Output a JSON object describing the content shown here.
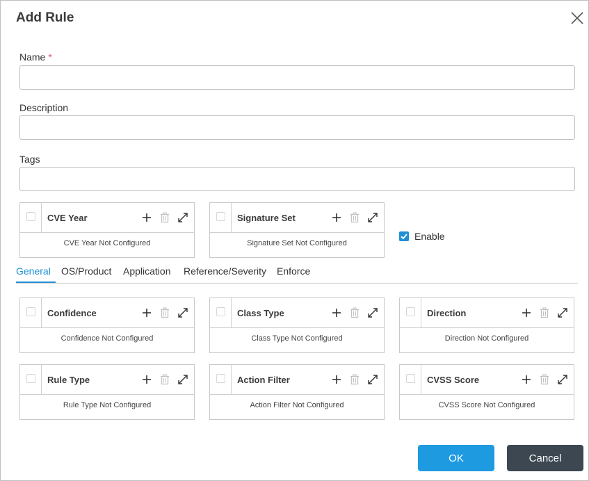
{
  "dialog": {
    "title": "Add Rule"
  },
  "form": {
    "name_label": "Name",
    "name_required_mark": "*",
    "name_value": "",
    "description_label": "Description",
    "description_value": "",
    "tags_label": "Tags",
    "tags_value": ""
  },
  "top_cards": [
    {
      "title": "CVE Year",
      "status": "CVE Year Not Configured"
    },
    {
      "title": "Signature Set",
      "status": "Signature Set Not Configured"
    }
  ],
  "enable": {
    "label": "Enable",
    "checked": true
  },
  "tabs": [
    "General",
    "OS/Product",
    "Application",
    "Reference/Severity",
    "Enforce"
  ],
  "active_tab": "General",
  "general_cards": [
    {
      "title": "Confidence",
      "status": "Confidence Not Configured"
    },
    {
      "title": "Class Type",
      "status": "Class Type Not Configured"
    },
    {
      "title": "Direction",
      "status": "Direction Not Configured"
    },
    {
      "title": "Rule Type",
      "status": "Rule Type Not Configured"
    },
    {
      "title": "Action Filter",
      "status": "Action Filter Not Configured"
    },
    {
      "title": "CVSS Score",
      "status": "CVSS Score Not Configured"
    }
  ],
  "icons": {
    "close": "close-icon",
    "add": "plus-icon",
    "delete": "trash-icon",
    "expand": "expand-icon"
  },
  "colors": {
    "accent": "#1f8fd6",
    "ok_button": "#1e9be0",
    "cancel_button": "#3c4752",
    "required": "#e0506a"
  },
  "buttons": {
    "ok": "OK",
    "cancel": "Cancel"
  }
}
